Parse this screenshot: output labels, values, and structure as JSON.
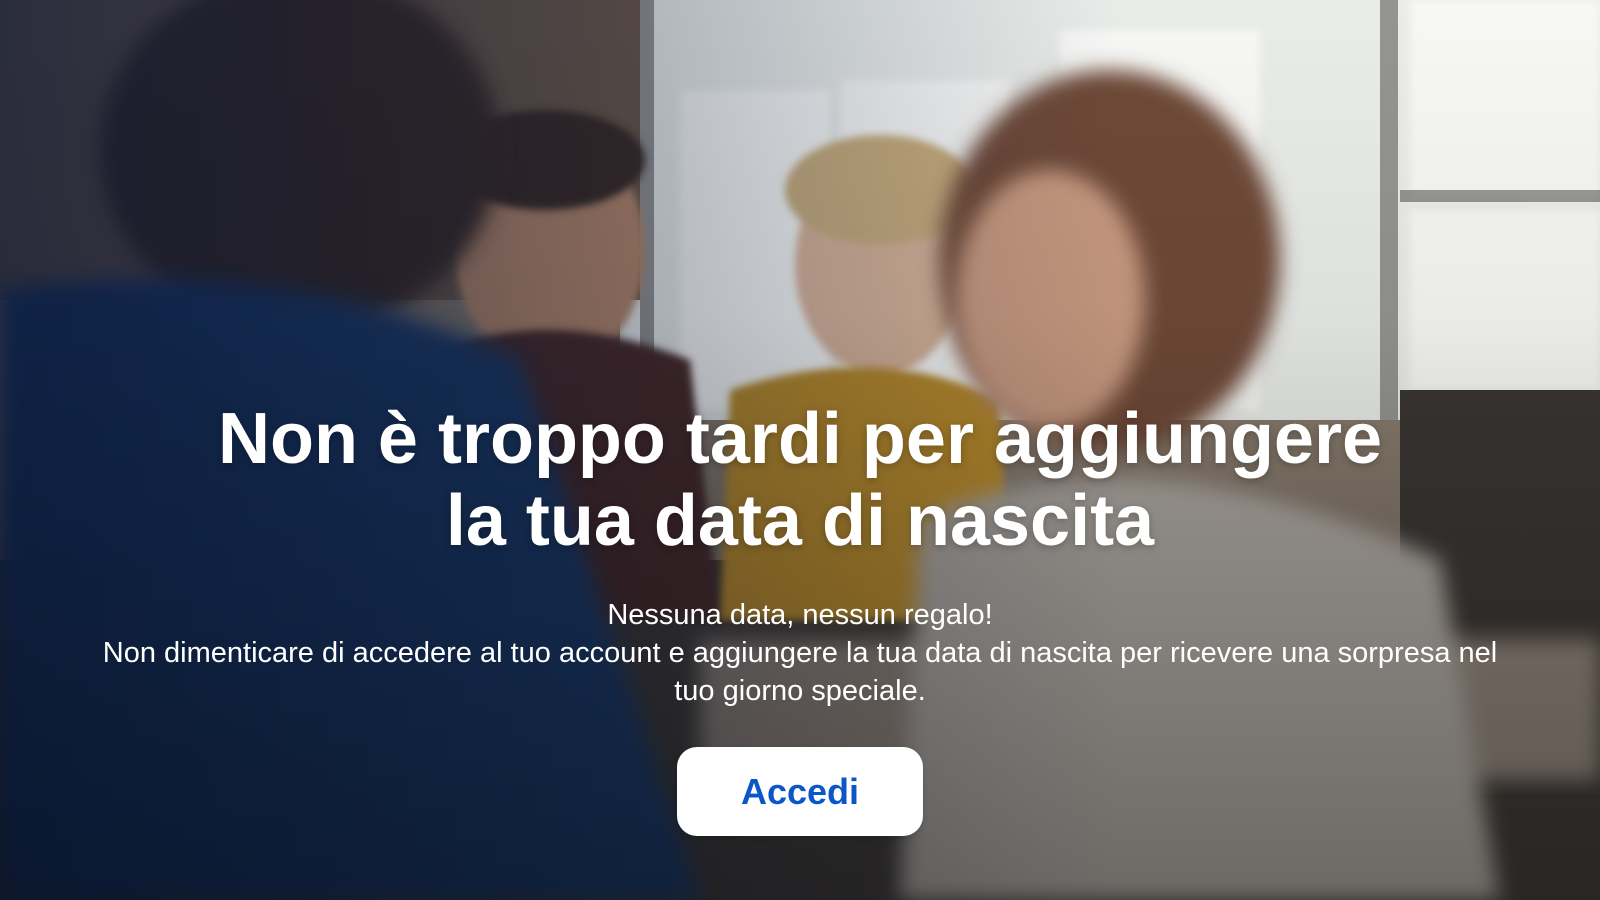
{
  "hero": {
    "headline_line1": "Non è troppo tardi per aggiungere",
    "headline_line2": "la tua data di nascita",
    "subtitle": "Nessuna data, nessun regalo!",
    "body": "Non dimenticare di accedere al tuo account e aggiungere la tua data di nascita per ricevere una sorpresa nel tuo giorno speciale.",
    "cta_label": "Accedi"
  },
  "colors": {
    "cta_text": "#0b57c9",
    "cta_background": "#ffffff",
    "text": "#ffffff"
  }
}
